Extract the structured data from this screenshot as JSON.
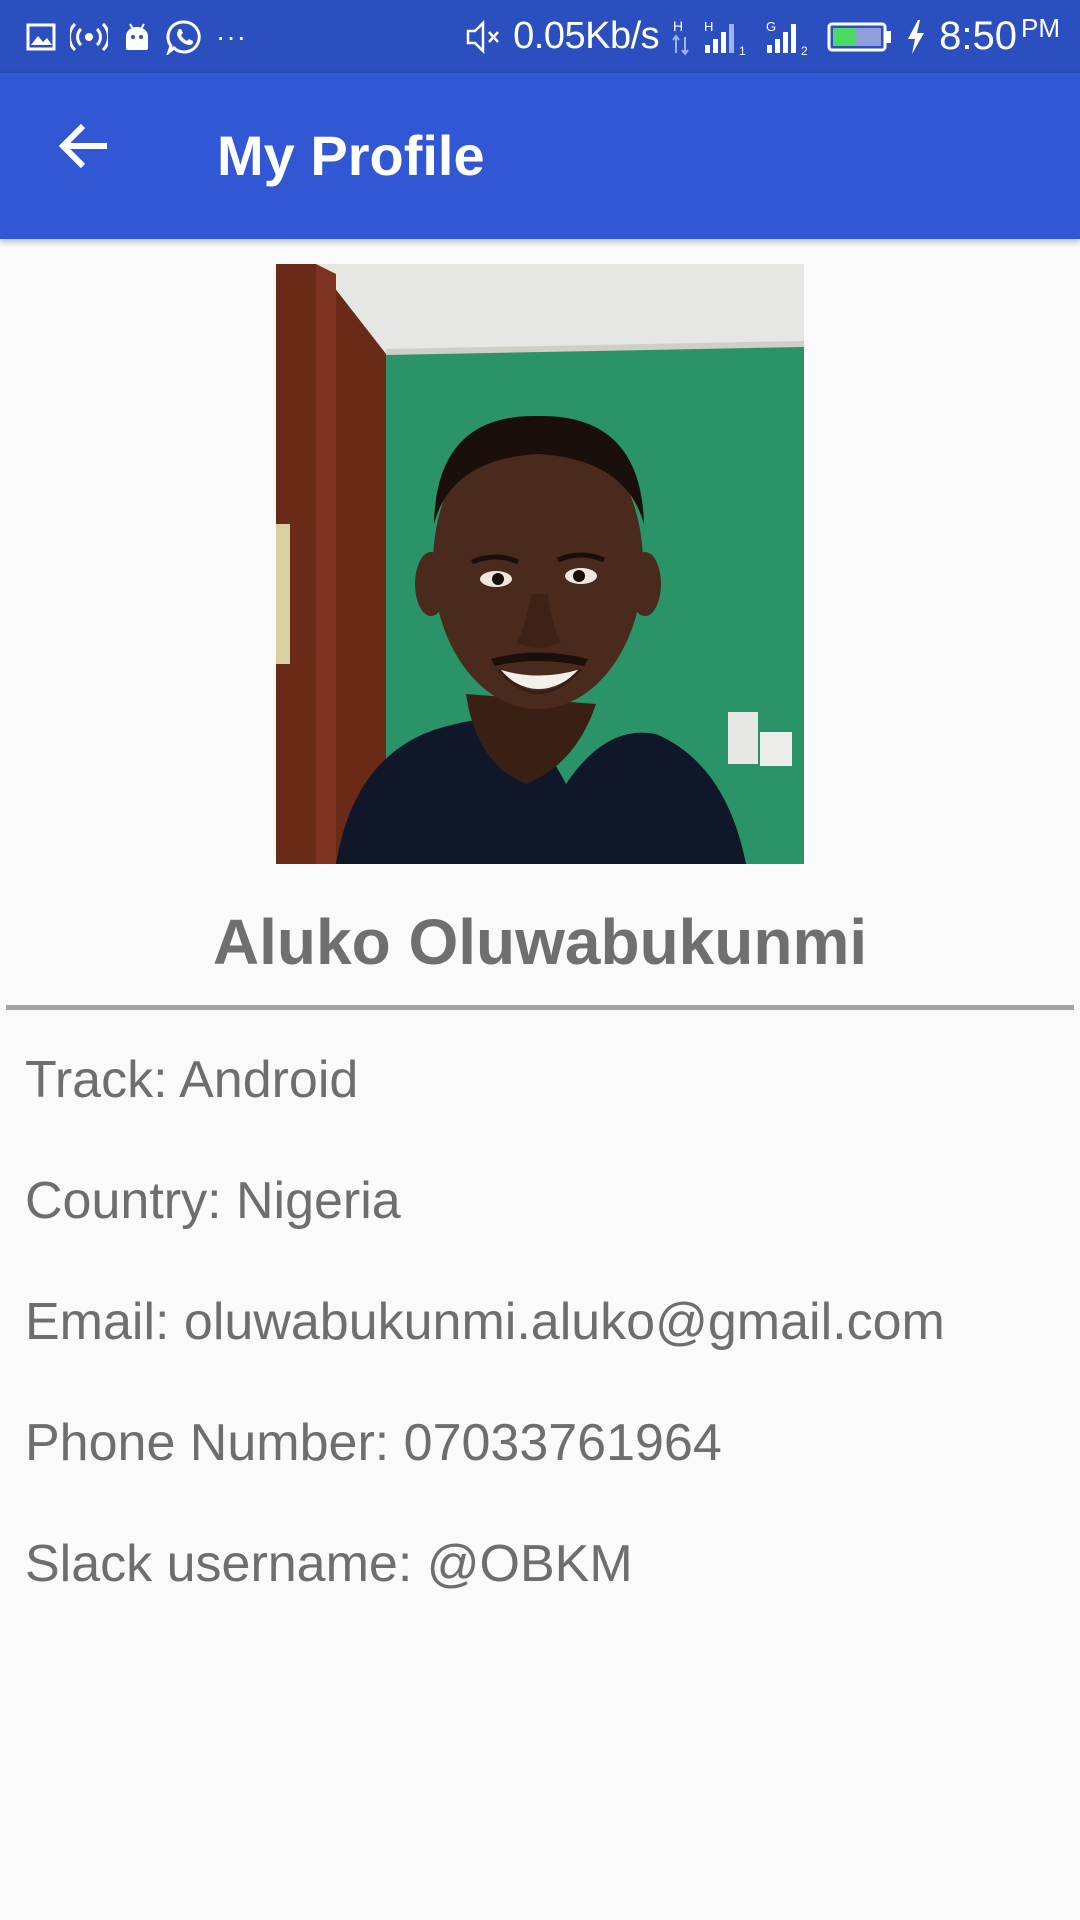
{
  "status_bar": {
    "network_speed": "0.05Kb/s",
    "time": "8:50",
    "time_suffix": "PM",
    "more": "···",
    "icons": [
      "gallery-icon",
      "hotspot-icon",
      "android-icon",
      "whatsapp-icon",
      "mute-icon",
      "data-arrows-icon",
      "signal-sim1-icon",
      "signal-sim2-icon",
      "battery-icon",
      "charging-icon"
    ],
    "sim1_type": "H",
    "sim2_type": "G",
    "battery_color": "#4cd964"
  },
  "app_bar": {
    "title": "My Profile",
    "back_icon": "arrow-left-icon",
    "color": "#3157d5"
  },
  "profile": {
    "name": "Aluko Oluwabukunmi",
    "details": [
      {
        "label": "Track: Android"
      },
      {
        "label": "Country: Nigeria"
      },
      {
        "label": "Email: oluwabukunmi.aluko@gmail.com"
      },
      {
        "label": "Phone Number: 07033761964"
      },
      {
        "label": "Slack username: @OBKM"
      }
    ]
  }
}
